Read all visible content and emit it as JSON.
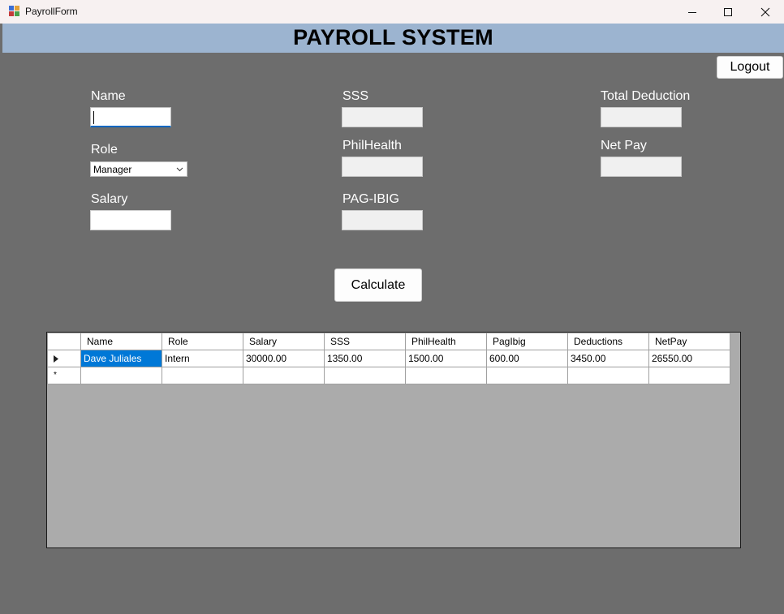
{
  "window": {
    "title": "PayrollForm"
  },
  "header": {
    "title": "PAYROLL SYSTEM"
  },
  "actions": {
    "logout_label": "Logout",
    "calculate_label": "Calculate"
  },
  "form": {
    "name": {
      "label": "Name",
      "value": ""
    },
    "role": {
      "label": "Role",
      "selected": "Manager"
    },
    "salary": {
      "label": "Salary",
      "value": ""
    },
    "sss": {
      "label": "SSS",
      "value": ""
    },
    "philhealth": {
      "label": "PhilHealth",
      "value": ""
    },
    "pagibig": {
      "label": "PAG-IBIG",
      "value": ""
    },
    "total_deduction": {
      "label": "Total Deduction",
      "value": ""
    },
    "net_pay": {
      "label": "Net Pay",
      "value": ""
    }
  },
  "grid": {
    "columns": [
      "Name",
      "Role",
      "Salary",
      "SSS",
      "PhilHealth",
      "PagIbig",
      "Deductions",
      "NetPay"
    ],
    "rows": [
      [
        "Dave Juliales",
        "Intern",
        "30000.00",
        "1350.00",
        "1500.00",
        "600.00",
        "3450.00",
        "26550.00"
      ]
    ],
    "new_row_marker": "*"
  },
  "colors": {
    "banner": "#9cb4d0",
    "background": "#6d6d6d",
    "selection": "#0078d7",
    "focus": "#0067c0"
  }
}
